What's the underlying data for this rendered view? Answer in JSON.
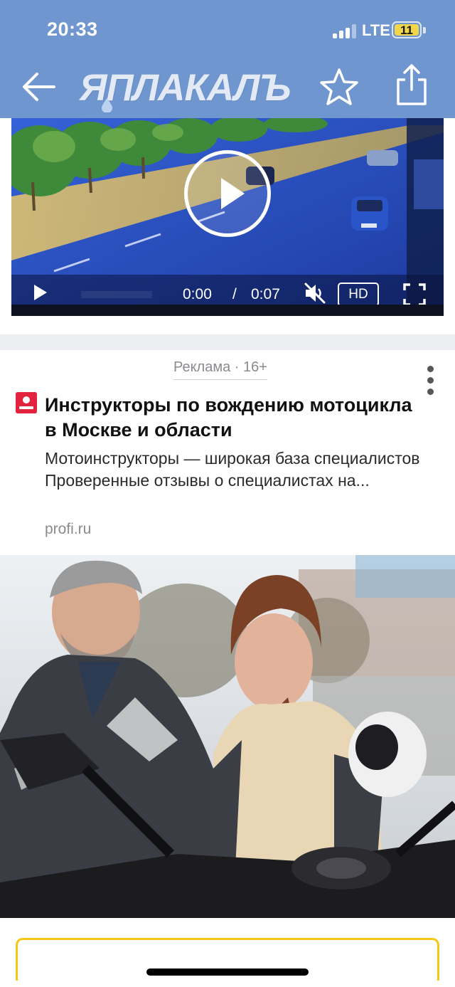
{
  "status_bar": {
    "time": "20:33",
    "network": "LTE",
    "battery_level": "11"
  },
  "header": {
    "logo_text": "ЯПЛАКАЛЪ",
    "icons": [
      "back-arrow-icon",
      "star-icon",
      "share-icon"
    ],
    "background_color": "#6f96cf"
  },
  "video": {
    "current_time": "0:00",
    "separator": "/",
    "duration": "0:07",
    "quality": "HD",
    "muted": true,
    "progress": 0
  },
  "ad": {
    "label": "Реклама · 16+",
    "title": "Инструкторы по вождению мотоцикла в Москве и области",
    "description": "Мотоинструкторы — широкая база специалистов Проверенные отзывы о специалистах на...",
    "domain": "profi.ru",
    "favicon_color": "#e3223e",
    "image_alt": "motorcycle instructor and student"
  },
  "colors": {
    "accent_yellow": "#f5c816",
    "separator": "#eceef2"
  }
}
